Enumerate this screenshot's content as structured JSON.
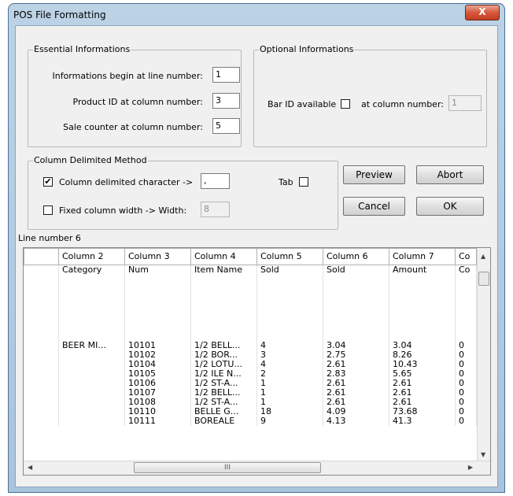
{
  "window": {
    "title": "POS File Formatting",
    "close_glyph": "X"
  },
  "essential": {
    "legend": "Essential Informations",
    "begin_label": "Informations begin at line number:",
    "begin_value": "1",
    "product_label": "Product ID at column number:",
    "product_value": "3",
    "sale_label": "Sale counter at column number:",
    "sale_value": "5"
  },
  "optional": {
    "legend": "Optional Informations",
    "barid_label": "Bar ID available",
    "barid_checked": false,
    "atcol_label": "at column number:",
    "atcol_value": "1"
  },
  "column_method": {
    "legend": "Column Delimited Method",
    "delim_label": "Column delimited character ->",
    "delim_checked": true,
    "delim_value": ",",
    "tab_label": "Tab",
    "tab_checked": false,
    "fixed_label": "Fixed column width ->  Width:",
    "fixed_checked": false,
    "width_value": "8"
  },
  "buttons": {
    "preview": "Preview",
    "abort": "Abort",
    "cancel": "Cancel",
    "ok": "OK"
  },
  "line_number_label": "Line number 6",
  "grid": {
    "headers": [
      "",
      "Column 2",
      "Column 3",
      "Column 4",
      "Column 5",
      "Column 6",
      "Column 7",
      "Co"
    ],
    "rows": [
      [
        "",
        "Category",
        "Num",
        "Item Name",
        "Sold",
        "Sold",
        "Amount",
        "Co"
      ],
      [
        "",
        "",
        "",
        "",
        "",
        "",
        "",
        ""
      ],
      [
        "",
        "",
        "",
        "",
        "",
        "",
        "",
        ""
      ],
      [
        "",
        "",
        "",
        "",
        "",
        "",
        "",
        ""
      ],
      [
        "",
        "",
        "",
        "",
        "",
        "",
        "",
        ""
      ],
      [
        "",
        "",
        "",
        "",
        "",
        "",
        "",
        ""
      ],
      [
        "",
        "",
        "",
        "",
        "",
        "",
        "",
        ""
      ],
      [
        "",
        "",
        "",
        "",
        "",
        "",
        "",
        ""
      ],
      [
        "",
        "BEER MI...",
        "10101",
        "1/2 BELL...",
        "4",
        "3.04",
        "3.04",
        "0"
      ],
      [
        "",
        "",
        "10102",
        "1/2 BOR...",
        "3",
        "2.75",
        "8.26",
        "0"
      ],
      [
        "",
        "",
        "10104",
        "1/2 LOTU...",
        "4",
        "2.61",
        "10.43",
        "0"
      ],
      [
        "",
        "",
        "10105",
        "1/2 ILE N...",
        "2",
        "2.83",
        "5.65",
        "0"
      ],
      [
        "",
        "",
        "10106",
        "1/2 ST-A...",
        "1",
        "2.61",
        "2.61",
        "0"
      ],
      [
        "",
        "",
        "10107",
        "1/2 BELL...",
        "1",
        "2.61",
        "2.61",
        "0"
      ],
      [
        "",
        "",
        "10108",
        "1/2 ST-A...",
        "1",
        "2.61",
        "2.61",
        "0"
      ],
      [
        "",
        "",
        "10110",
        "BELLE G...",
        "18",
        "4.09",
        "73.68",
        "0"
      ],
      [
        "",
        "",
        "10111",
        "BOREALE",
        "9",
        "4.13",
        "41.3",
        "0"
      ]
    ]
  },
  "scroll": {
    "up": "▲",
    "down": "▼",
    "left": "◀",
    "right": "▶",
    "thumb": "III"
  },
  "icons": {
    "check": "✔"
  }
}
